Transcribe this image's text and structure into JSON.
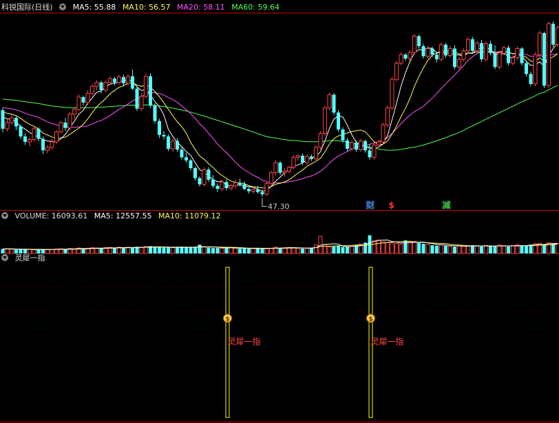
{
  "header": {
    "title": "科锐国际(日线)",
    "ma5": "MA5: 55.88",
    "ma10": "MA10: 56.57",
    "ma20": "MA20: 58.11",
    "ma60": "MA60: 59.64"
  },
  "volume_header": {
    "label": "VOLUME: 16093.61",
    "ma5": "MA5: 12557.55",
    "ma10": "MA10: 11079.12"
  },
  "indicator_header": {
    "label": "灵犀一指"
  },
  "colors": {
    "up": "#ff4444",
    "down": "#54ffff",
    "ma5": "#ffffff",
    "ma10": "#ffff55",
    "ma20": "#ff55ff",
    "ma60": "#55ff55",
    "border": "#cc0000",
    "signal": "#ffff00"
  },
  "chart_data": [
    {
      "type": "candlestick",
      "title": "科锐国际(日线)",
      "ylim": [
        45.5,
        70.5
      ],
      "min_marker": {
        "index": 58,
        "value": "47.30"
      },
      "event_markers": [
        {
          "index": 82,
          "label": "财"
        },
        {
          "index": 87,
          "label": "$"
        },
        {
          "index": 99,
          "label": "减"
        }
      ],
      "ohlc": [
        [
          58.0,
          58.3,
          55.1,
          55.6
        ],
        [
          55.6,
          56.9,
          55.2,
          56.4
        ],
        [
          56.4,
          57.5,
          56.1,
          57.0
        ],
        [
          57.0,
          57.3,
          55.4,
          55.9
        ],
        [
          55.9,
          56.1,
          54.3,
          54.6
        ],
        [
          54.6,
          55.0,
          53.5,
          53.9
        ],
        [
          53.9,
          54.5,
          53.3,
          54.2
        ],
        [
          54.2,
          55.9,
          53.9,
          55.6
        ],
        [
          55.6,
          55.8,
          54.0,
          54.3
        ],
        [
          54.3,
          54.6,
          52.3,
          52.8
        ],
        [
          52.8,
          53.5,
          52.4,
          53.2
        ],
        [
          53.2,
          54.3,
          52.9,
          53.9
        ],
        [
          53.9,
          55.4,
          53.6,
          55.2
        ],
        [
          55.2,
          56.6,
          55.0,
          56.4
        ],
        [
          56.4,
          57.0,
          55.3,
          55.7
        ],
        [
          55.7,
          57.8,
          55.4,
          57.5
        ],
        [
          57.5,
          58.4,
          56.8,
          58.1
        ],
        [
          58.1,
          60.1,
          57.9,
          59.7
        ],
        [
          59.7,
          59.9,
          58.6,
          59.0
        ],
        [
          59.0,
          60.6,
          58.7,
          60.2
        ],
        [
          60.2,
          61.4,
          59.9,
          61.1
        ],
        [
          61.1,
          61.9,
          60.6,
          61.6
        ],
        [
          61.6,
          61.8,
          60.2,
          60.6
        ],
        [
          60.6,
          61.9,
          60.3,
          61.6
        ],
        [
          61.6,
          62.4,
          61.3,
          62.1
        ],
        [
          62.1,
          62.3,
          61.2,
          61.6
        ],
        [
          61.6,
          62.6,
          61.3,
          62.3
        ],
        [
          62.3,
          62.6,
          61.1,
          61.5
        ],
        [
          61.5,
          62.7,
          61.2,
          62.4
        ],
        [
          62.4,
          63.3,
          60.6,
          60.8
        ],
        [
          60.8,
          61.0,
          57.9,
          58.2
        ],
        [
          58.2,
          60.2,
          57.9,
          59.8
        ],
        [
          59.8,
          62.7,
          59.5,
          62.4
        ],
        [
          62.4,
          62.8,
          58.3,
          58.6
        ],
        [
          58.6,
          58.9,
          56.3,
          56.6
        ],
        [
          56.6,
          56.9,
          54.4,
          54.8
        ],
        [
          54.8,
          55.3,
          54.2,
          54.6
        ],
        [
          54.6,
          54.9,
          52.7,
          53.0
        ],
        [
          53.0,
          54.3,
          52.6,
          54.0
        ],
        [
          54.0,
          54.4,
          52.6,
          52.9
        ],
        [
          52.9,
          53.2,
          51.6,
          51.9
        ],
        [
          51.9,
          52.5,
          51.2,
          51.5
        ],
        [
          51.5,
          51.7,
          50.2,
          50.5
        ],
        [
          50.5,
          50.7,
          48.9,
          49.2
        ],
        [
          49.2,
          49.4,
          48.1,
          48.4
        ],
        [
          48.4,
          50.6,
          48.1,
          50.3
        ],
        [
          50.3,
          50.6,
          48.7,
          49.0
        ],
        [
          49.0,
          49.6,
          47.9,
          48.2
        ],
        [
          48.2,
          48.5,
          47.4,
          47.8
        ],
        [
          47.8,
          49.0,
          47.5,
          48.7
        ],
        [
          48.7,
          49.0,
          47.6,
          47.9
        ],
        [
          47.9,
          48.5,
          47.6,
          48.2
        ],
        [
          48.2,
          49.0,
          47.9,
          48.6
        ],
        [
          48.6,
          49.1,
          48.1,
          48.4
        ],
        [
          48.4,
          48.8,
          47.6,
          47.8
        ],
        [
          47.8,
          48.0,
          47.2,
          47.5
        ],
        [
          47.5,
          48.1,
          47.2,
          47.7
        ],
        [
          47.7,
          48.2,
          47.2,
          47.4
        ],
        [
          47.4,
          47.7,
          46.8,
          47.1
        ],
        [
          47.1,
          48.8,
          46.9,
          48.5
        ],
        [
          48.5,
          50.2,
          48.2,
          49.9
        ],
        [
          49.9,
          51.5,
          49.6,
          51.2
        ],
        [
          51.2,
          51.4,
          49.6,
          49.9
        ],
        [
          49.9,
          50.5,
          49.4,
          50.1
        ],
        [
          50.1,
          50.8,
          49.8,
          50.6
        ],
        [
          50.6,
          52.2,
          50.3,
          51.9
        ],
        [
          51.9,
          52.3,
          51.5,
          52.1
        ],
        [
          52.1,
          52.4,
          50.9,
          51.2
        ],
        [
          51.2,
          52.3,
          50.9,
          52.0
        ],
        [
          52.0,
          52.3,
          51.4,
          51.7
        ],
        [
          51.7,
          53.5,
          51.5,
          53.2
        ],
        [
          53.2,
          55.3,
          52.9,
          55.0
        ],
        [
          55.0,
          58.6,
          54.7,
          58.3
        ],
        [
          58.3,
          60.3,
          58.0,
          60.0
        ],
        [
          60.0,
          60.2,
          57.4,
          57.7
        ],
        [
          57.7,
          58.0,
          55.2,
          55.5
        ],
        [
          55.5,
          55.8,
          53.8,
          54.1
        ],
        [
          54.1,
          54.4,
          52.7,
          53.0
        ],
        [
          53.0,
          54.1,
          52.7,
          53.8
        ],
        [
          53.8,
          54.1,
          52.6,
          52.9
        ],
        [
          52.9,
          54.3,
          52.6,
          54.0
        ],
        [
          54.0,
          54.2,
          52.5,
          52.8
        ],
        [
          52.8,
          53.6,
          51.6,
          51.9
        ],
        [
          51.9,
          53.8,
          51.6,
          53.5
        ],
        [
          53.5,
          54.2,
          53.2,
          53.9
        ],
        [
          53.9,
          56.4,
          53.6,
          56.1
        ],
        [
          56.1,
          58.6,
          55.8,
          58.3
        ],
        [
          58.3,
          62.3,
          58.0,
          62.0
        ],
        [
          62.0,
          64.4,
          61.7,
          64.1
        ],
        [
          64.1,
          65.5,
          63.8,
          65.2
        ],
        [
          65.2,
          65.4,
          64.4,
          64.7
        ],
        [
          64.7,
          65.8,
          64.4,
          65.5
        ],
        [
          65.5,
          67.9,
          65.2,
          67.6
        ],
        [
          67.6,
          67.8,
          66.0,
          66.3
        ],
        [
          66.3,
          66.6,
          64.7,
          65.0
        ],
        [
          65.0,
          66.3,
          64.7,
          66.0
        ],
        [
          66.0,
          66.2,
          64.9,
          65.2
        ],
        [
          65.2,
          65.6,
          64.2,
          64.6
        ],
        [
          64.6,
          66.8,
          64.3,
          66.5
        ],
        [
          66.5,
          66.7,
          64.8,
          65.1
        ],
        [
          65.1,
          66.3,
          64.8,
          66.0
        ],
        [
          66.0,
          66.4,
          63.3,
          63.6
        ],
        [
          63.6,
          64.9,
          63.3,
          64.6
        ],
        [
          64.6,
          66.0,
          64.3,
          65.7
        ],
        [
          65.7,
          67.5,
          65.4,
          67.2
        ],
        [
          67.2,
          67.5,
          65.4,
          65.7
        ],
        [
          65.7,
          67.0,
          65.4,
          66.7
        ],
        [
          66.7,
          67.1,
          64.3,
          64.6
        ],
        [
          64.6,
          66.9,
          64.3,
          66.6
        ],
        [
          66.6,
          67.0,
          65.1,
          65.4
        ],
        [
          65.4,
          66.4,
          63.3,
          63.6
        ],
        [
          63.6,
          65.7,
          63.3,
          65.4
        ],
        [
          65.4,
          66.4,
          65.1,
          66.1
        ],
        [
          66.1,
          66.4,
          63.8,
          64.1
        ],
        [
          64.1,
          65.1,
          63.8,
          64.8
        ],
        [
          64.8,
          66.3,
          64.5,
          66.0
        ],
        [
          66.0,
          66.2,
          63.8,
          64.1
        ],
        [
          64.1,
          64.4,
          62.4,
          62.7
        ],
        [
          62.7,
          63.0,
          61.1,
          61.4
        ],
        [
          61.4,
          65.5,
          61.1,
          65.2
        ],
        [
          65.2,
          68.3,
          64.9,
          68.0
        ],
        [
          68.0,
          68.2,
          60.9,
          61.2
        ],
        [
          61.2,
          69.5,
          60.9,
          69.2
        ],
        [
          69.2,
          69.5,
          66.2,
          66.5
        ],
        [
          66.5,
          69.0,
          66.2,
          68.7
        ]
      ]
    },
    {
      "type": "bar",
      "title": "VOLUME",
      "ylim": [
        0,
        45000
      ],
      "values": [
        6800,
        7200,
        6500,
        5900,
        6300,
        5800,
        6100,
        5600,
        5900,
        6400,
        5700,
        6200,
        6800,
        7100,
        6600,
        7500,
        7000,
        8200,
        7400,
        7900,
        8600,
        8100,
        7300,
        8800,
        9100,
        8400,
        9600,
        8700,
        9300,
        8800,
        9900,
        9400,
        10300,
        10900,
        9800,
        9200,
        8700,
        9300,
        8600,
        9500,
        10100,
        9200,
        8800,
        9900,
        13200,
        9600,
        8700,
        8100,
        8300,
        7800,
        9000,
        8500,
        7900,
        7300,
        7600,
        7000,
        7400,
        8100,
        7500,
        7200,
        7900,
        9500,
        8200,
        8700,
        9100,
        8400,
        7900,
        7300,
        7600,
        8000,
        12800,
        25600,
        13500,
        9800,
        10400,
        11200,
        9700,
        10100,
        10900,
        12600,
        14100,
        16200,
        27100,
        18900,
        20100,
        17600,
        16700,
        15600,
        14800,
        13900,
        19500,
        17200,
        17800,
        15900,
        14300,
        13600,
        12400,
        11800,
        12900,
        11500,
        10800,
        10200,
        11300,
        10900,
        11600,
        12200,
        11000,
        10500,
        11900,
        11300,
        10700,
        12500,
        11100,
        10300,
        11700,
        12800,
        11900,
        12200,
        13300,
        14600,
        15200,
        12800,
        16100,
        15200,
        14900
      ],
      "ma5_label": "MA5: 12557.55",
      "ma10_label": "MA10: 11079.12"
    },
    {
      "type": "signal",
      "title": "灵犀一指",
      "signal_indices": [
        49,
        81
      ],
      "signal_label": "灵犀一指"
    }
  ]
}
